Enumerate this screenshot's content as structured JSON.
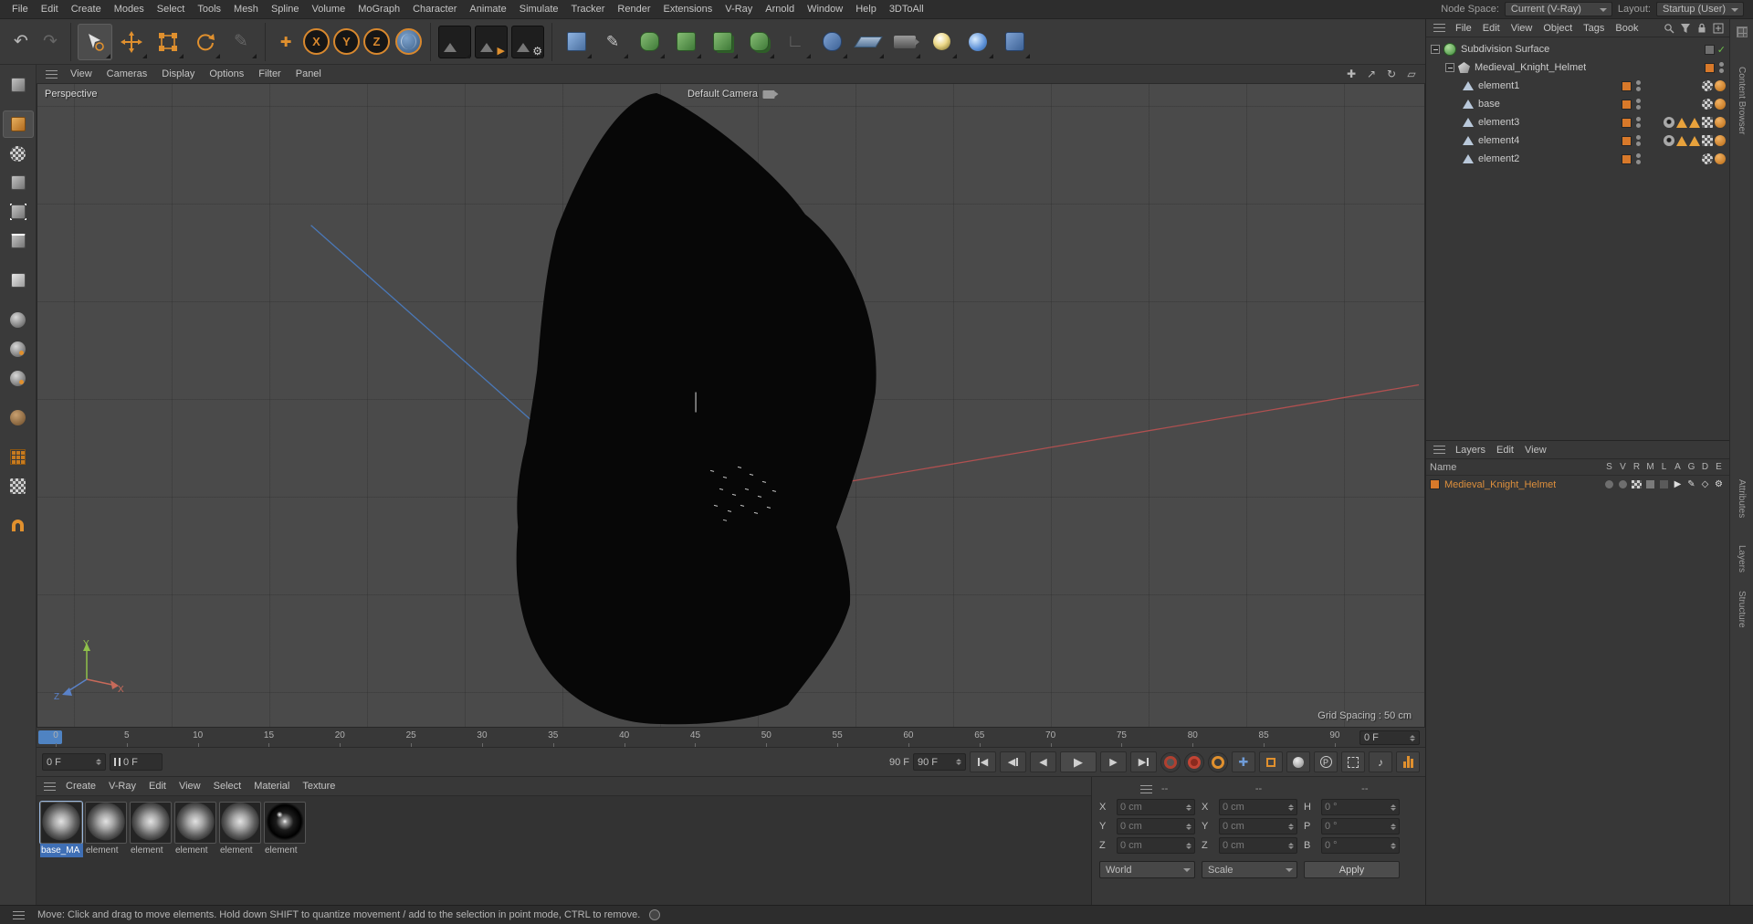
{
  "colors": {
    "accent": "#e0902e",
    "selection_blue": "#3f6fb5",
    "layer_orange": "#d8792a"
  },
  "menubar": {
    "items": [
      "File",
      "Edit",
      "Create",
      "Modes",
      "Select",
      "Tools",
      "Mesh",
      "Spline",
      "Volume",
      "MoGraph",
      "Character",
      "Animate",
      "Simulate",
      "Tracker",
      "Render",
      "Extensions",
      "V-Ray",
      "Arnold",
      "Window",
      "Help",
      "3DToAll"
    ],
    "node_space_label": "Node Space:",
    "node_space_value": "Current (V-Ray)",
    "layout_label": "Layout:",
    "layout_value": "Startup (User)"
  },
  "toolbar": {
    "axis_buttons": [
      "X",
      "Y",
      "Z"
    ]
  },
  "viewport": {
    "menu": [
      "View",
      "Cameras",
      "Display",
      "Options",
      "Filter",
      "Panel"
    ],
    "view_label": "Perspective",
    "camera_label": "Default Camera",
    "grid_spacing": "Grid Spacing : 50 cm",
    "axis_x": "X",
    "axis_y": "Y",
    "axis_z": "Z"
  },
  "object_manager": {
    "menu": [
      "File",
      "Edit",
      "View",
      "Object",
      "Tags",
      "Book"
    ],
    "rows": [
      {
        "name": "Subdivision Surface"
      },
      {
        "name": "Medieval_Knight_Helmet"
      },
      {
        "name": "element1",
        "tags": [
          "texture",
          "mat"
        ]
      },
      {
        "name": "base",
        "tags": [
          "texture",
          "mat"
        ]
      },
      {
        "name": "element3",
        "tags": [
          "eye",
          "phong",
          "phong",
          "uvw",
          "mat"
        ]
      },
      {
        "name": "element4",
        "tags": [
          "eye",
          "phong",
          "phong",
          "uvw",
          "mat"
        ]
      },
      {
        "name": "element2",
        "tags": [
          "texture",
          "mat"
        ]
      }
    ]
  },
  "layers_panel": {
    "menu": [
      "Layers",
      "Edit",
      "View"
    ],
    "name_header": "Name",
    "columns": [
      "S",
      "V",
      "R",
      "M",
      "L",
      "A",
      "G",
      "D",
      "E"
    ],
    "rows": [
      {
        "name": "Medieval_Knight_Helmet"
      }
    ]
  },
  "timeline": {
    "ticks": [
      "0",
      "5",
      "10",
      "15",
      "20",
      "25",
      "30",
      "35",
      "40",
      "45",
      "50",
      "55",
      "60",
      "65",
      "70",
      "75",
      "80",
      "85",
      "90"
    ],
    "ruler_frame_box": "0 F",
    "start_field": "0 F",
    "current_field": "0 F",
    "end_label": "90 F",
    "end_field": "90 F",
    "parameter_label": "P"
  },
  "materials": {
    "menu": [
      "Create",
      "V-Ray",
      "Edit",
      "View",
      "Select",
      "Material",
      "Texture"
    ],
    "items": [
      {
        "label": "base_MA",
        "state": "sel"
      },
      {
        "label": "element"
      },
      {
        "label": "element"
      },
      {
        "label": "element"
      },
      {
        "label": "element"
      },
      {
        "label": "element",
        "finish": "shiny"
      }
    ]
  },
  "coordinates": {
    "headers": [
      "--",
      "--",
      "--"
    ],
    "rows": [
      {
        "pos_label": "X",
        "pos": "0 cm",
        "size_label": "X",
        "size": "0 cm",
        "rot_label": "H",
        "rot": "0 °"
      },
      {
        "pos_label": "Y",
        "pos": "0 cm",
        "size_label": "Y",
        "size": "0 cm",
        "rot_label": "P",
        "rot": "0 °"
      },
      {
        "pos_label": "Z",
        "pos": "0 cm",
        "size_label": "Z",
        "size": "0 cm",
        "rot_label": "B",
        "rot": "0 °"
      }
    ],
    "world": "World",
    "scale": "Scale",
    "apply": "Apply"
  },
  "side_tabs": {
    "content_browser": "Content Browser",
    "attributes": "Attributes",
    "layers": "Layers",
    "structure": "Structure"
  },
  "status_bar": {
    "text": "Move: Click and drag to move elements. Hold down SHIFT to quantize movement / add to the selection in point mode, CTRL to remove."
  }
}
